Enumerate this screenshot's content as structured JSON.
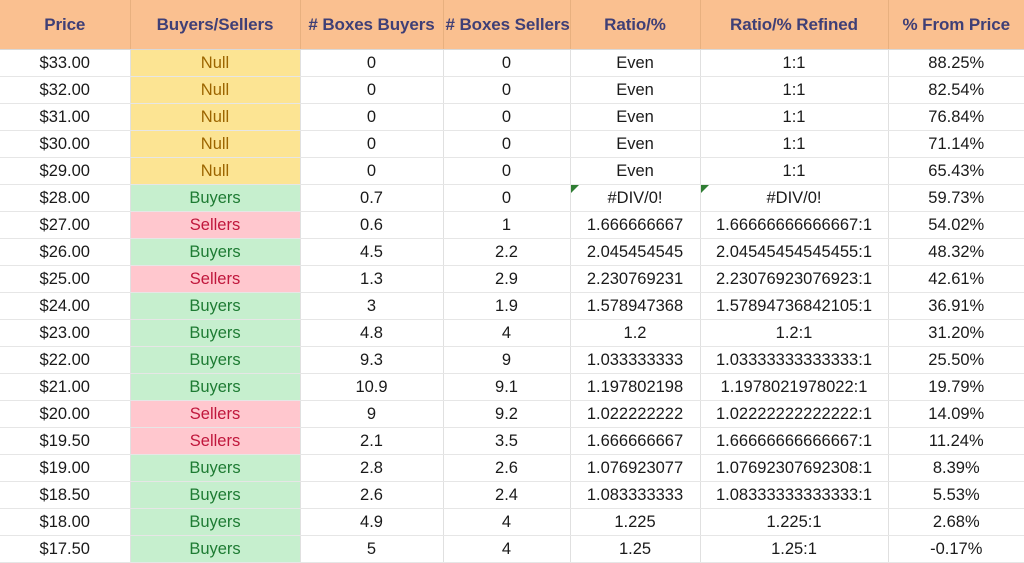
{
  "table": {
    "columns": [
      "Price",
      "Buyers/Sellers",
      "# Boxes Buyers",
      "# Boxes Sellers",
      "Ratio/%",
      "Ratio/% Refined",
      "% From Price"
    ],
    "colors": {
      "header_background": "#FAC090",
      "header_text": "#3F3F76",
      "null_fill": "#FCE493",
      "null_text": "#9C6500",
      "buyers_fill": "#C6EFCE",
      "buyers_text": "#1E7B33",
      "sellers_fill": "#FFC7CE",
      "sellers_text": "#C0173C",
      "error_indicator": "#2E7D32",
      "cell_text": "#1A1A1A",
      "gridline": "#E6E6E6"
    },
    "rows": [
      {
        "price": "$33.00",
        "side": "Null",
        "side_fill": "null",
        "boxes_buyers": "0",
        "boxes_sellers": "0",
        "ratio": "Even",
        "ratio_refined": "1:1",
        "pct_from_price": "88.25%",
        "error_ratio": false,
        "error_refined": false
      },
      {
        "price": "$32.00",
        "side": "Null",
        "side_fill": "null",
        "boxes_buyers": "0",
        "boxes_sellers": "0",
        "ratio": "Even",
        "ratio_refined": "1:1",
        "pct_from_price": "82.54%",
        "error_ratio": false,
        "error_refined": false
      },
      {
        "price": "$31.00",
        "side": "Null",
        "side_fill": "null",
        "boxes_buyers": "0",
        "boxes_sellers": "0",
        "ratio": "Even",
        "ratio_refined": "1:1",
        "pct_from_price": "76.84%",
        "error_ratio": false,
        "error_refined": false
      },
      {
        "price": "$30.00",
        "side": "Null",
        "side_fill": "null",
        "boxes_buyers": "0",
        "boxes_sellers": "0",
        "ratio": "Even",
        "ratio_refined": "1:1",
        "pct_from_price": "71.14%",
        "error_ratio": false,
        "error_refined": false
      },
      {
        "price": "$29.00",
        "side": "Null",
        "side_fill": "null",
        "boxes_buyers": "0",
        "boxes_sellers": "0",
        "ratio": "Even",
        "ratio_refined": "1:1",
        "pct_from_price": "65.43%",
        "error_ratio": false,
        "error_refined": false
      },
      {
        "price": "$28.00",
        "side": "Buyers",
        "side_fill": "buyers",
        "boxes_buyers": "0.7",
        "boxes_sellers": "0",
        "ratio": "#DIV/0!",
        "ratio_refined": "#DIV/0!",
        "pct_from_price": "59.73%",
        "error_ratio": true,
        "error_refined": true
      },
      {
        "price": "$27.00",
        "side": "Sellers",
        "side_fill": "sellers",
        "boxes_buyers": "0.6",
        "boxes_sellers": "1",
        "ratio": "1.666666667",
        "ratio_refined": "1.66666666666667:1",
        "pct_from_price": "54.02%",
        "error_ratio": false,
        "error_refined": false
      },
      {
        "price": "$26.00",
        "side": "Buyers",
        "side_fill": "buyers",
        "boxes_buyers": "4.5",
        "boxes_sellers": "2.2",
        "ratio": "2.045454545",
        "ratio_refined": "2.04545454545455:1",
        "pct_from_price": "48.32%",
        "error_ratio": false,
        "error_refined": false
      },
      {
        "price": "$25.00",
        "side": "Sellers",
        "side_fill": "sellers",
        "boxes_buyers": "1.3",
        "boxes_sellers": "2.9",
        "ratio": "2.230769231",
        "ratio_refined": "2.23076923076923:1",
        "pct_from_price": "42.61%",
        "error_ratio": false,
        "error_refined": false
      },
      {
        "price": "$24.00",
        "side": "Buyers",
        "side_fill": "buyers",
        "boxes_buyers": "3",
        "boxes_sellers": "1.9",
        "ratio": "1.578947368",
        "ratio_refined": "1.57894736842105:1",
        "pct_from_price": "36.91%",
        "error_ratio": false,
        "error_refined": false
      },
      {
        "price": "$23.00",
        "side": "Buyers",
        "side_fill": "buyers",
        "boxes_buyers": "4.8",
        "boxes_sellers": "4",
        "ratio": "1.2",
        "ratio_refined": "1.2:1",
        "pct_from_price": "31.20%",
        "error_ratio": false,
        "error_refined": false
      },
      {
        "price": "$22.00",
        "side": "Buyers",
        "side_fill": "buyers",
        "boxes_buyers": "9.3",
        "boxes_sellers": "9",
        "ratio": "1.033333333",
        "ratio_refined": "1.03333333333333:1",
        "pct_from_price": "25.50%",
        "error_ratio": false,
        "error_refined": false
      },
      {
        "price": "$21.00",
        "side": "Buyers",
        "side_fill": "buyers",
        "boxes_buyers": "10.9",
        "boxes_sellers": "9.1",
        "ratio": "1.197802198",
        "ratio_refined": "1.1978021978022:1",
        "pct_from_price": "19.79%",
        "error_ratio": false,
        "error_refined": false
      },
      {
        "price": "$20.00",
        "side": "Sellers",
        "side_fill": "sellers",
        "boxes_buyers": "9",
        "boxes_sellers": "9.2",
        "ratio": "1.022222222",
        "ratio_refined": "1.02222222222222:1",
        "pct_from_price": "14.09%",
        "error_ratio": false,
        "error_refined": false
      },
      {
        "price": "$19.50",
        "side": "Sellers",
        "side_fill": "sellers",
        "boxes_buyers": "2.1",
        "boxes_sellers": "3.5",
        "ratio": "1.666666667",
        "ratio_refined": "1.66666666666667:1",
        "pct_from_price": "11.24%",
        "error_ratio": false,
        "error_refined": false
      },
      {
        "price": "$19.00",
        "side": "Buyers",
        "side_fill": "buyers",
        "boxes_buyers": "2.8",
        "boxes_sellers": "2.6",
        "ratio": "1.076923077",
        "ratio_refined": "1.07692307692308:1",
        "pct_from_price": "8.39%",
        "error_ratio": false,
        "error_refined": false
      },
      {
        "price": "$18.50",
        "side": "Buyers",
        "side_fill": "buyers",
        "boxes_buyers": "2.6",
        "boxes_sellers": "2.4",
        "ratio": "1.083333333",
        "ratio_refined": "1.08333333333333:1",
        "pct_from_price": "5.53%",
        "error_ratio": false,
        "error_refined": false
      },
      {
        "price": "$18.00",
        "side": "Buyers",
        "side_fill": "buyers",
        "boxes_buyers": "4.9",
        "boxes_sellers": "4",
        "ratio": "1.225",
        "ratio_refined": "1.225:1",
        "pct_from_price": "2.68%",
        "error_ratio": false,
        "error_refined": false
      },
      {
        "price": "$17.50",
        "side": "Buyers",
        "side_fill": "buyers",
        "boxes_buyers": "5",
        "boxes_sellers": "4",
        "ratio": "1.25",
        "ratio_refined": "1.25:1",
        "pct_from_price": "-0.17%",
        "error_ratio": false,
        "error_refined": false
      }
    ]
  }
}
